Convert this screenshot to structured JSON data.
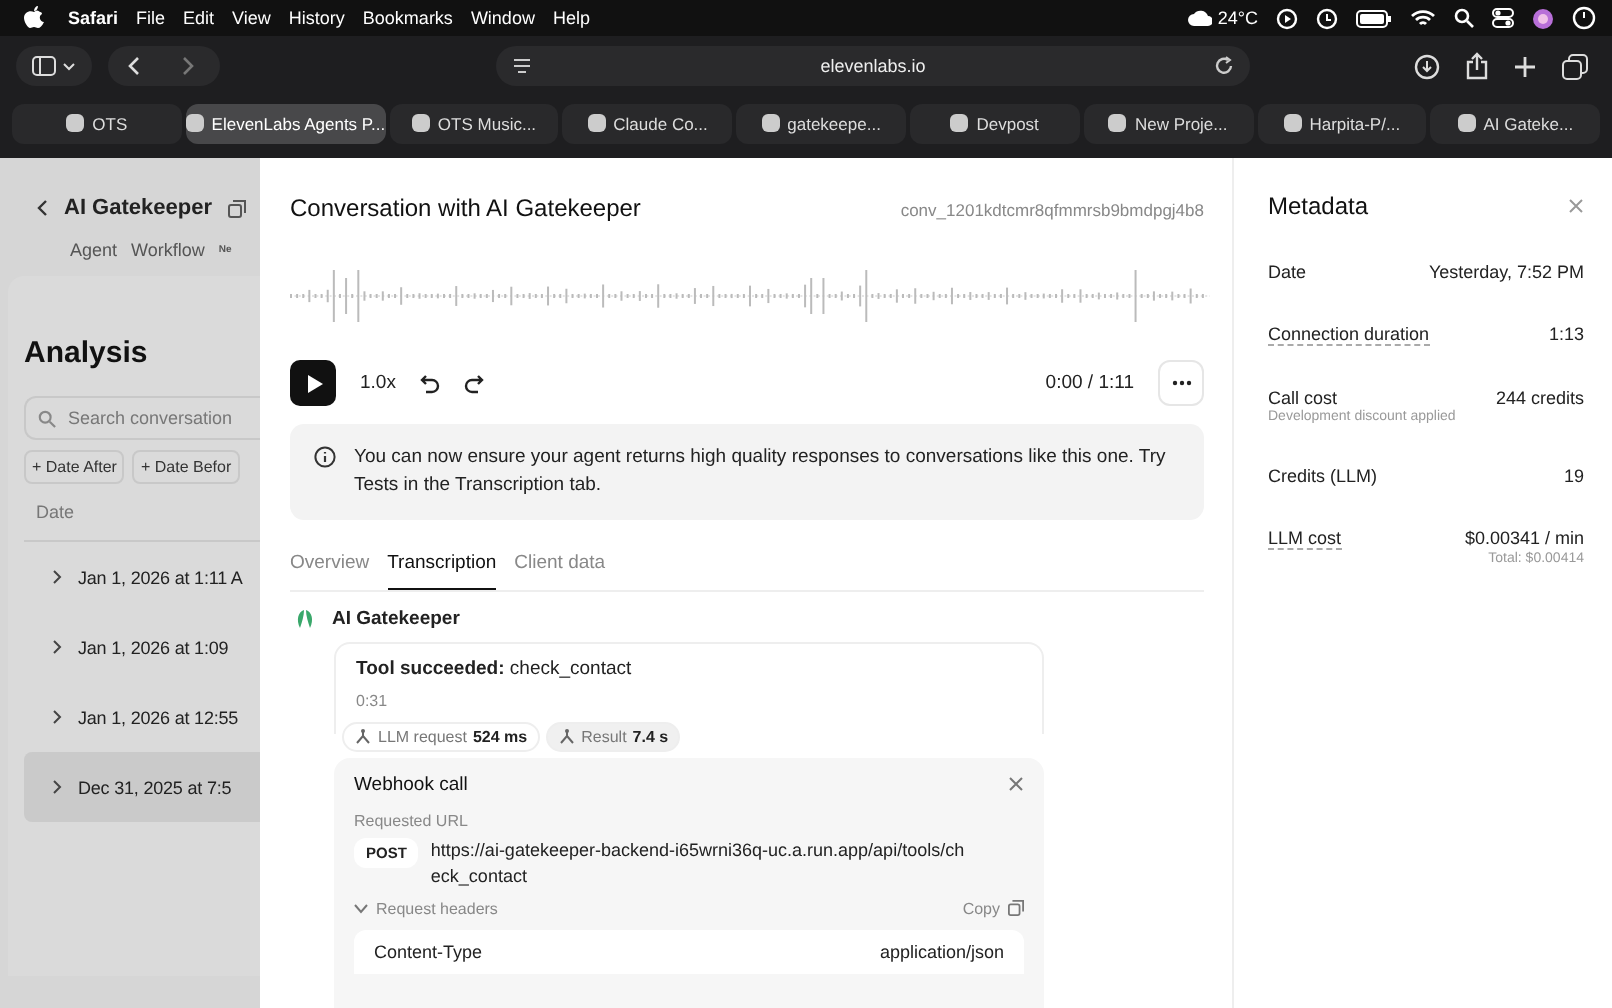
{
  "menubar": {
    "app": "Safari",
    "menus": [
      "File",
      "Edit",
      "View",
      "History",
      "Bookmarks",
      "Window",
      "Help"
    ],
    "temperature": "24°C"
  },
  "browser": {
    "url": "elevenlabs.io",
    "tabs": [
      {
        "label": "OTS",
        "selected": false
      },
      {
        "label": "ElevenLabs Agents P...",
        "selected": true
      },
      {
        "label": "OTS Music...",
        "selected": false
      },
      {
        "label": "Claude Co...",
        "selected": false
      },
      {
        "label": "gatekeepe...",
        "selected": false
      },
      {
        "label": "Devpost",
        "selected": false
      },
      {
        "label": "New Proje...",
        "selected": false
      },
      {
        "label": "Harpita-P/...",
        "selected": false
      },
      {
        "label": "AI Gateke...",
        "selected": false
      }
    ]
  },
  "background_page": {
    "agent_name": "AI Gatekeeper",
    "nav": [
      "Agent",
      "Workflow"
    ],
    "nav_badge": "Ne",
    "title": "Analysis",
    "search": {
      "placeholder": "Search conversation"
    },
    "filters": [
      "+ Date After",
      "+ Date Befor"
    ],
    "column": "Date",
    "rows": [
      {
        "date": "Jan 1, 2026 at 1:11 A",
        "selected": false
      },
      {
        "date": "Jan 1, 2026 at 1:09",
        "selected": false
      },
      {
        "date": "Jan 1, 2026 at 12:55",
        "selected": false
      },
      {
        "date": "Dec 31, 2025 at 7:5",
        "selected": true
      }
    ]
  },
  "conversation": {
    "title": "Conversation with AI Gatekeeper",
    "id": "conv_1201kdtcmr8qfmmrsb9bmdpgj4b8",
    "speed": "1.0x",
    "time": "0:00 / 1:11",
    "notice": "You can now ensure your agent returns high quality responses to conversations like this one. Try Tests in the Transcription tab.",
    "tabs": [
      {
        "label": "Overview",
        "selected": false
      },
      {
        "label": "Transcription",
        "selected": true
      },
      {
        "label": "Client data",
        "selected": false
      }
    ],
    "speaker": "AI Gatekeeper",
    "tool": {
      "status": "**Tool succeeded:** check_contact",
      "time": "0:31",
      "chips": [
        {
          "label": "LLM request",
          "value": "524 ms",
          "selected": false
        },
        {
          "label": "Result",
          "value": "7.4 s",
          "selected": true
        }
      ]
    },
    "webhook": {
      "title": "Webhook call",
      "url_label": "Requested URL",
      "method": "POST",
      "url": "https://ai-gatekeeper-backend-i65wrni36q-uc.a.run.app/api/tools/check_contact",
      "headers_label": "Request headers",
      "expanded": true,
      "copy": "Copy",
      "headers": [
        {
          "name": "Content-Type",
          "value": "application/json"
        }
      ]
    }
  },
  "metadata": {
    "title": "Metadata",
    "rows": [
      {
        "label": "Date",
        "value": "Yesterday, 7:52 PM",
        "dotted": false
      },
      {
        "label": "Connection duration",
        "value": "1:13",
        "dotted": true
      },
      {
        "label": "Call cost",
        "value": "244 credits",
        "note": "Development discount applied",
        "dotted": false
      },
      {
        "label": "Credits (LLM)",
        "value": "19",
        "dotted": false
      },
      {
        "label": "LLM cost",
        "value": "$0.00341 / min",
        "note": "Total: $0.00414",
        "dotted": true
      }
    ]
  }
}
